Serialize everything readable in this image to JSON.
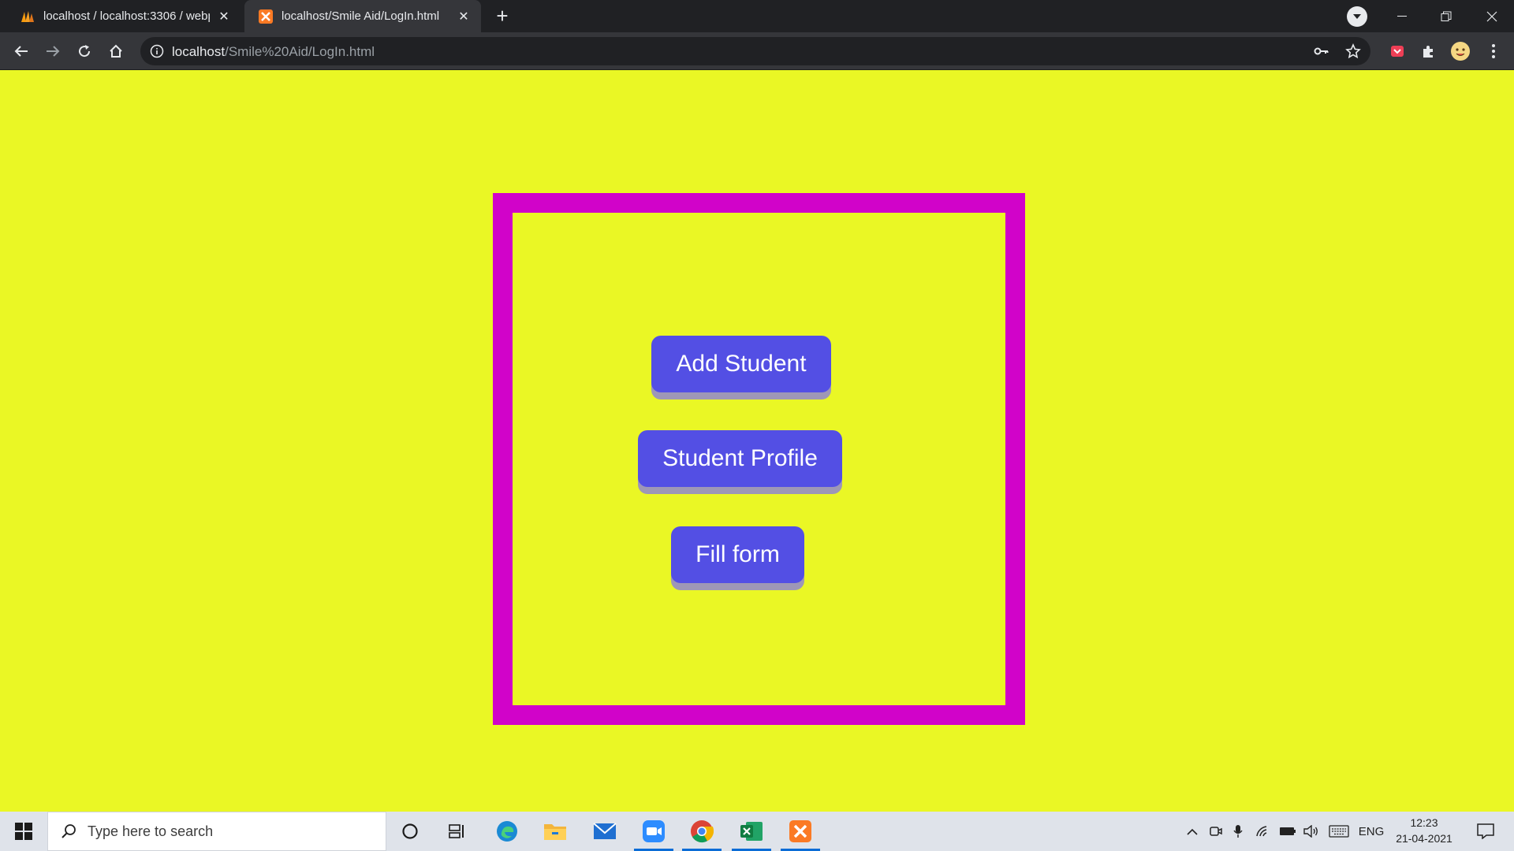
{
  "browser": {
    "tabs": [
      {
        "title": "localhost / localhost:3306 / webp",
        "active": false
      },
      {
        "title": "localhost/Smile Aid/LogIn.html",
        "active": true
      }
    ],
    "url_host": "localhost",
    "url_path": "/Smile%20Aid/LogIn.html"
  },
  "page": {
    "background": "#eaf725",
    "frame_color": "#d103c9",
    "button_color": "#534fe4",
    "buttons": {
      "add_student": "Add Student",
      "student_profile": "Student Profile",
      "fill_form": "Fill form"
    }
  },
  "taskbar": {
    "search_placeholder": "Type here to search",
    "apps": [
      "cortana",
      "task-view",
      "edge",
      "file-explorer",
      "mail",
      "zoom",
      "chrome",
      "excel",
      "xampp"
    ],
    "language": "ENG",
    "time": "12:23",
    "date": "21-04-2021"
  }
}
